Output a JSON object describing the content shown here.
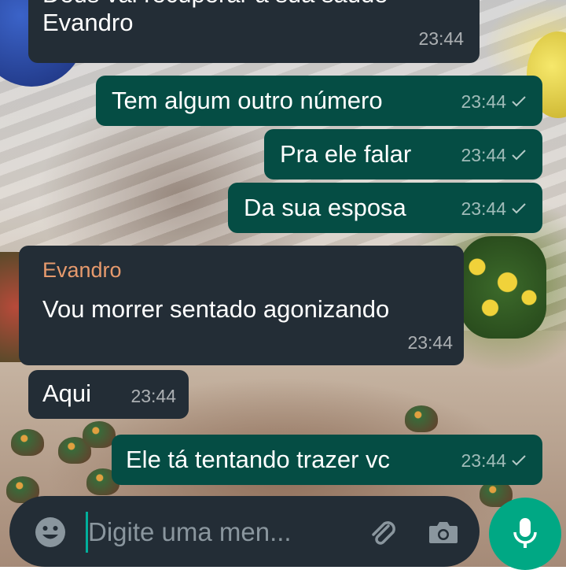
{
  "messages": [
    {
      "direction": "in",
      "lines": [
        "Deus vai recuperar a sua saúde",
        "Evandro"
      ],
      "time": "23:44"
    },
    {
      "direction": "out",
      "text": "Tem algum outro número",
      "time": "23:44",
      "status": "sent"
    },
    {
      "direction": "out",
      "text": "Pra ele falar",
      "time": "23:44",
      "status": "sent"
    },
    {
      "direction": "out",
      "text": "Da sua esposa",
      "time": "23:44",
      "status": "sent"
    },
    {
      "direction": "in",
      "sender": "Evandro",
      "text": "Vou morrer sentado agonizando",
      "time": "23:44"
    },
    {
      "direction": "in",
      "text": "Aqui",
      "time": "23:44"
    },
    {
      "direction": "out",
      "text": "Ele tá tentando trazer vc",
      "time": "23:44",
      "status": "sent"
    }
  ],
  "composer": {
    "placeholder": "Digite uma men...",
    "emoji_icon": "emoji-icon",
    "attach_icon": "paperclip-icon",
    "camera_icon": "camera-icon",
    "mic_icon": "microphone-icon"
  },
  "colors": {
    "incoming_bubble": "#232d36",
    "outgoing_bubble": "#054d44",
    "sender_name": "#e79a6d",
    "accent": "#00a884"
  }
}
